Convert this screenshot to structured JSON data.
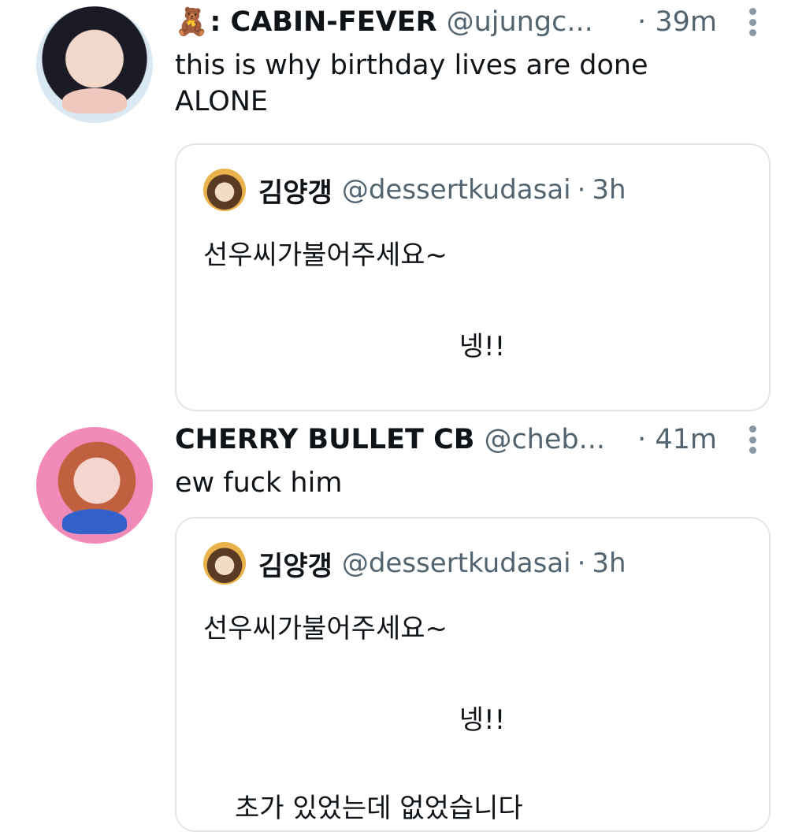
{
  "tweets": [
    {
      "emoji": "🧸",
      "name": ": CABIN-FEVER",
      "handle": "@ujungc...",
      "time": "· 39m",
      "text": "this is why birthday lives are done\nALONE",
      "quote": {
        "name": "김양갱",
        "handle": "@dessertkudasai",
        "dot": "·",
        "time": "3h",
        "line1": "선우씨가불어주세요~",
        "line2": "넹!!"
      }
    },
    {
      "name": "CHERRY BULLET CB",
      "handle": "@cheb...",
      "time": "· 41m",
      "text": "ew fuck him",
      "quote": {
        "name": "김양갱",
        "handle": "@dessertkudasai",
        "dot": "·",
        "time": "3h",
        "line1": "선우씨가불어주세요~",
        "line2": "넹!!",
        "line3": "초가 있었는데 없었습니다"
      }
    }
  ]
}
